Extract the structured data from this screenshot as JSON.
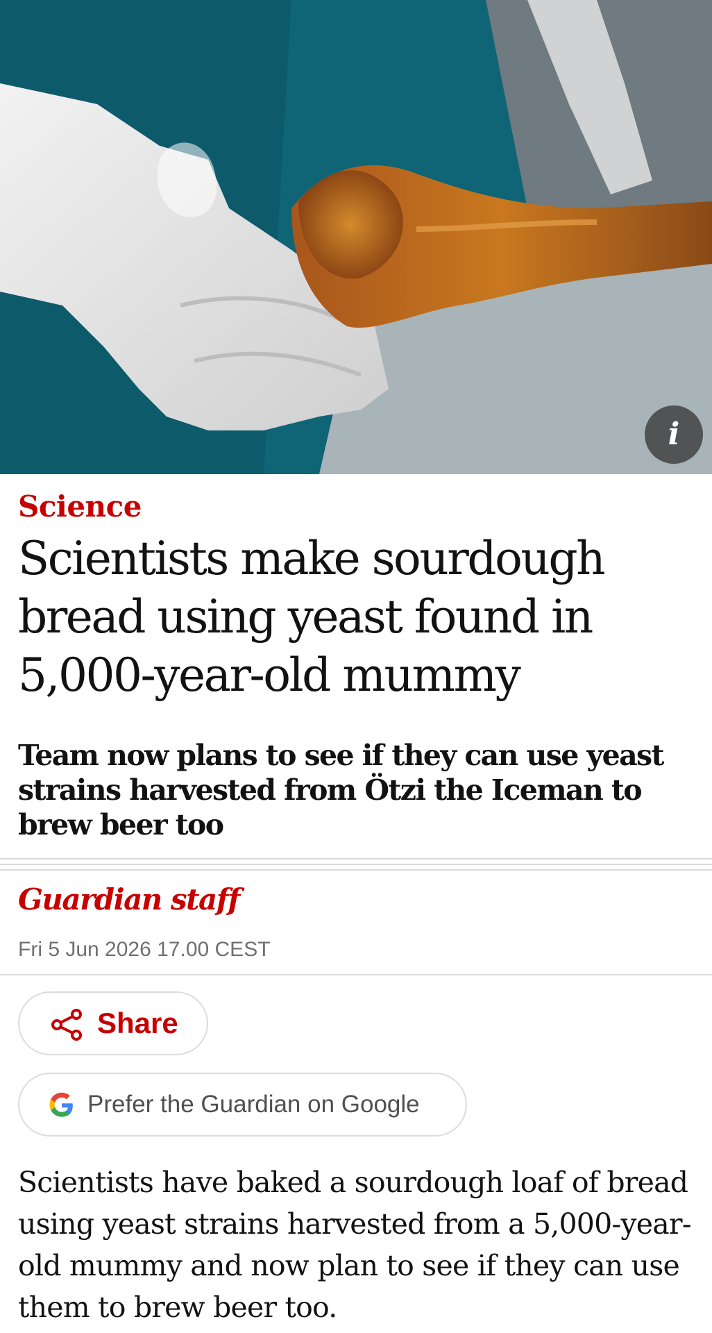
{
  "hero": {
    "info_label": "i",
    "icon": "info-icon"
  },
  "article": {
    "kicker": "Science",
    "headline": "Scientists make sourdough bread using yeast found in 5,000-year-old mummy",
    "standfirst": "Team now plans to see if they can use yeast strains harvested from Ötzi the Iceman to brew beer too",
    "byline": "Guardian staff",
    "dateline": "Fri 5 Jun 2026 17.00 CEST",
    "body": "Scientists have baked a sourdough loaf of bread using yeast strains harvested from a 5,000-year-old mummy and now plan to see if they can use them to brew beer too."
  },
  "actions": {
    "share_label": "Share",
    "share_icon": "share-icon",
    "google_label": "Prefer the Guardian on Google",
    "google_icon": "google-g-icon"
  },
  "colors": {
    "accent_red": "#c70000",
    "text": "#121212",
    "muted": "#707070"
  }
}
